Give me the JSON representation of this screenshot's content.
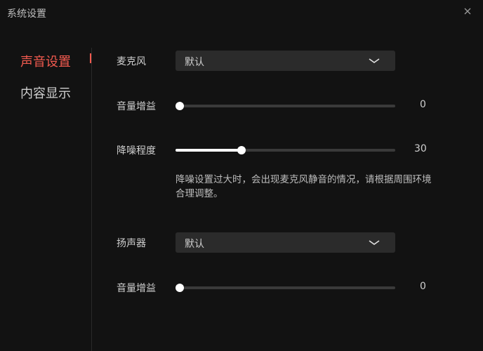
{
  "window": {
    "title": "系统设置"
  },
  "sidebar": {
    "items": [
      {
        "label": "声音设置",
        "active": true
      },
      {
        "label": "内容显示",
        "active": false
      }
    ]
  },
  "microphone": {
    "label": "麦克风",
    "selected": "默认"
  },
  "mic_gain": {
    "label": "音量增益",
    "value": 0,
    "max": 100
  },
  "noise_reduction": {
    "label": "降噪程度",
    "value": 30,
    "max": 100,
    "note": "降噪设置过大时，会出现麦克风静音的情况，请根据周围环境合理调整。"
  },
  "speaker": {
    "label": "扬声器",
    "selected": "默认"
  },
  "speaker_gain": {
    "label": "音量增益",
    "value": 0,
    "max": 100
  },
  "colors": {
    "accent": "#f25a4f",
    "background": "#121212",
    "control_bg": "#2b2b2b",
    "track": "#3a3a3a"
  }
}
